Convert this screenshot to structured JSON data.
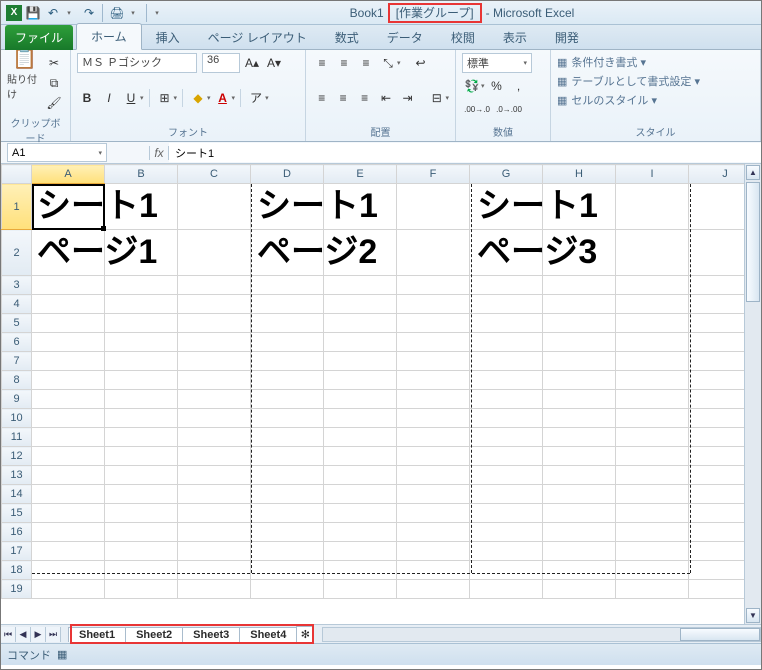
{
  "title": {
    "book": "Book1",
    "group_tag": "[作業グループ]",
    "app": "- Microsoft Excel"
  },
  "qat": {
    "excel_icon": "X",
    "save": "💾",
    "undo": "↶",
    "redo": "↷",
    "print": "🖨"
  },
  "tabs": {
    "file": "ファイル",
    "home": "ホーム",
    "insert": "挿入",
    "page_layout": "ページ レイアウト",
    "formulas": "数式",
    "data": "データ",
    "review": "校閲",
    "view": "表示",
    "developer": "開発"
  },
  "ribbon": {
    "clipboard": {
      "paste": "貼り付け",
      "cut": "✂",
      "copy": "⧉",
      "fmt": "🖌",
      "label": "クリップボード"
    },
    "font": {
      "name": "ＭＳ Ｐゴシック",
      "size": "36",
      "grow": "A▴",
      "shrink": "A▾",
      "bold": "B",
      "italic": "I",
      "underline": "U",
      "border": "⊞",
      "fill": "◆",
      "color": "A",
      "phonetic": "ア",
      "label": "フォント"
    },
    "align": {
      "top": "≡",
      "mid": "≡",
      "bot": "≡",
      "orient": "⤡",
      "left": "≡",
      "center": "≡",
      "right": "≡",
      "indent_dec": "⇤",
      "indent_inc": "⇥",
      "wrap": "↩",
      "merge": "⊟",
      "label": "配置"
    },
    "number": {
      "format": "標準",
      "currency": "💱",
      "percent": "%",
      "comma": ",",
      "inc_dec": ".00→.0",
      "dec_dec": ".0→.00",
      "label": "数値"
    },
    "styles": {
      "cond": "条件付き書式 ▾",
      "table": "テーブルとして書式設定 ▾",
      "cell": "セルのスタイル ▾",
      "label": "スタイル"
    }
  },
  "formula_bar": {
    "name_box": "A1",
    "fx": "fx",
    "value": "シート1"
  },
  "columns": [
    "A",
    "B",
    "C",
    "D",
    "E",
    "F",
    "G",
    "H",
    "I",
    "J"
  ],
  "rows": [
    "1",
    "2",
    "3",
    "4",
    "5",
    "6",
    "7",
    "8",
    "9",
    "10",
    "11",
    "12",
    "13",
    "14",
    "15",
    "16",
    "17",
    "18",
    "19"
  ],
  "content": {
    "b1_l1": "シート1",
    "b1_l2": "ページ1",
    "b2_l1": "シート1",
    "b2_l2": "ページ2",
    "b3_l1": "シート1",
    "b3_l2": "ページ3"
  },
  "sheet_tabs": [
    "Sheet1",
    "Sheet2",
    "Sheet3",
    "Sheet4"
  ],
  "status": {
    "mode": "コマンド",
    "macro_icon": "▦"
  }
}
